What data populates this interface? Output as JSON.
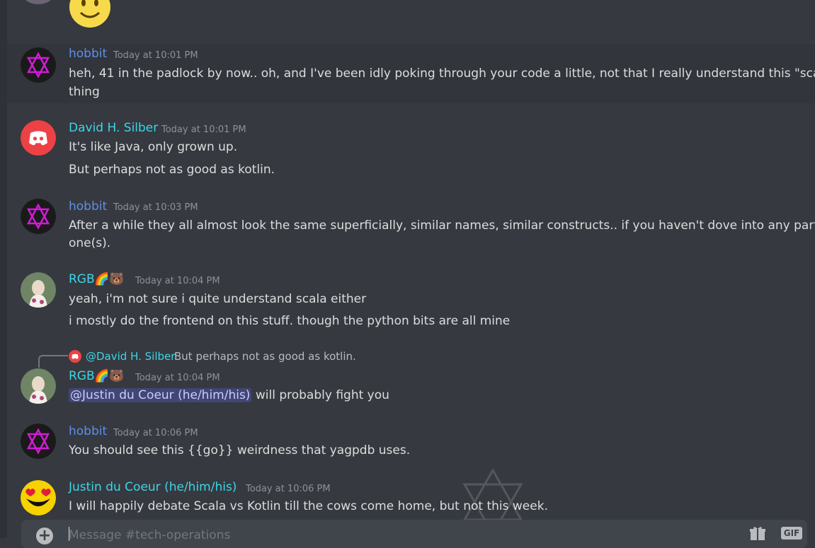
{
  "composer": {
    "placeholder": "Message #tech-operations",
    "plus_label": "+",
    "gif_label": "GIF"
  },
  "messages": [
    {
      "author": "hobbit",
      "time": "Today at 10:01 PM",
      "lines": [
        "heh, 41 in the padlock by now.. oh, and I've been idly poking through your code a little, not that I really understand this \"scala\"",
        "thing"
      ]
    },
    {
      "author": "David H. Silber",
      "time": "Today at 10:01 PM",
      "lines": [
        "It's like Java, only grown up.",
        "But perhaps not as good as kotlin."
      ]
    },
    {
      "author": "hobbit",
      "time": "Today at 10:03 PM",
      "lines": [
        "After a while they all almost look the same superficially, similar names, similar constructs.. if you haven't dove into any particular",
        "one(s)."
      ]
    },
    {
      "author": "RGB",
      "time": "Today at 10:04 PM",
      "lines": [
        "yeah, i'm not sure i quite understand scala either",
        "i mostly do the frontend on this stuff. though the python bits are all mine"
      ]
    },
    {
      "author": "RGB",
      "time": "Today at 10:04 PM",
      "reply": {
        "author": "@David H. Silber",
        "text": "But perhaps not as good as kotlin."
      },
      "mention": "@Justin du Coeur (he/him/his)",
      "text": "will probably fight you"
    },
    {
      "author": "hobbit",
      "time": "Today at 10:06 PM",
      "lines": [
        "You should see this {{go}} weirdness that yagpdb uses."
      ]
    },
    {
      "author": "Justin du Coeur (he/him/his)",
      "time": "Today at 10:06 PM",
      "lines": [
        "I will happily debate Scala vs Kotlin till the cows come home, but not this week."
      ]
    }
  ],
  "colors": {
    "background": "#36393f",
    "hobbit_name": "#5e8fe8",
    "cyan_name": "#3dd5e8",
    "mention_bg": "#414675"
  }
}
